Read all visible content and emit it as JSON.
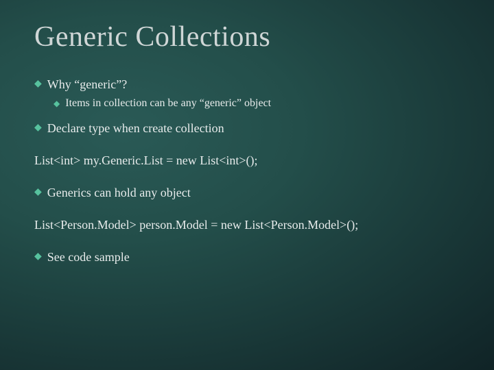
{
  "title": "Generic Collections",
  "items": {
    "b1": "Why “generic”?",
    "b1a": "Items in collection can be any “generic” object",
    "b2": "Declare type when create collection",
    "code1": "List<int> my.Generic.List = new List<int>();",
    "b3": "Generics can hold any object",
    "code2": "List<Person.Model> person.Model = new List<Person.Model>();",
    "b4": "See code sample"
  }
}
